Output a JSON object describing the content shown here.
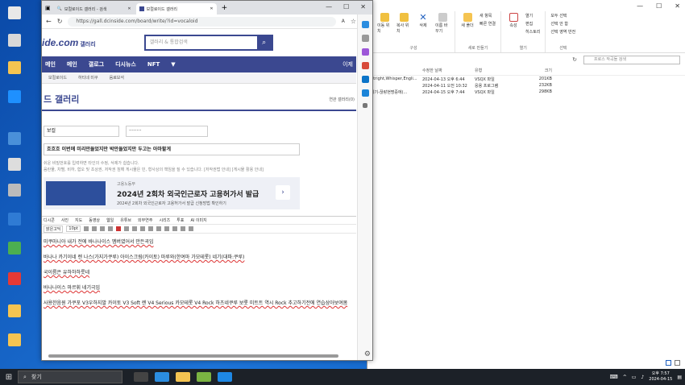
{
  "browser": {
    "tabs": [
      {
        "title": "보컬로이드 갤러리 - 검색"
      },
      {
        "title": "보컬로이드 갤러리"
      }
    ],
    "new_tab": "+",
    "url": "https://gall.dcinside.com/board/write/?id=vocaloid"
  },
  "site": {
    "logo": "ide.com",
    "logo_sub": "갤러리",
    "search_placeholder": "갤러리 & 통합검색",
    "menu": [
      "메인",
      "메인",
      "갤로그",
      "디시뉴스",
      "NFT"
    ],
    "menu_right": "이제",
    "sub_menu": [
      "보컬로이드",
      "하티네 미쿠",
      "음료보석"
    ],
    "gallery_title": "드 갤러리",
    "gallery_link": "연관 갤러리(0)"
  },
  "form": {
    "nickname": "보컬",
    "password": "········",
    "subject": "흐흐흐 이번에 미리만들었지만 박만들었지만 두고는 아마할게",
    "notice1": "쉬운 비밀번호를 입력하면 타인의 수정, 삭제가 쉽습니다.",
    "notice2": "음란물, 차별, 비하, 혐오 및 초상권, 저작권 침해 게시물은 민, 형사상의 책임을 질 수 있습니다. [저작권법 안내] [게시물 활용 안내]"
  },
  "ad": {
    "small": "고용노동부",
    "headline": "2024년 2회차 외국인근로자 고용허가서 발급",
    "desc": "2024년 2회차 외국인근로자 고용허가서 발급 신청방법 확인하기"
  },
  "toolbar": {
    "row1": [
      "디시콘",
      "사진",
      "지도",
      "동영상",
      "웹일",
      "유튜브",
      "외부연주",
      "시리즈",
      "투표",
      "AI 이미지"
    ],
    "font": "맑은고딕",
    "size": "10pt"
  },
  "editor": {
    "lines": [
      "미쿠마니아 내가 전에 바나나이스 멤버였어서 만든곡임",
      "바나나 카기이네 렌 나스(가지가쿠루)  아이스크림(카이토) 마루와(한여마 가모테롯) 네기(대파:쿠루)",
      "국이름은 유하하하릇네",
      "바나나이스 마르휘 네기극임",
      "사용한음원 가쿠포 V3우하지발  카이토 V3 Soft 렌 V4 Serious 카모테롯 V4 Rock 하츠네쿠루 보롯 미트트 역시 Rock 추고하기전에 연습삼아보여봄"
    ]
  },
  "explorer": {
    "ribbon": {
      "groups": [
        {
          "caption": "구성",
          "buttons": [
            "이동 위치",
            "복사 위치",
            "삭제",
            "이름 바꾸기"
          ]
        },
        {
          "caption": "새로 만들기",
          "buttons": [
            "새 폴더",
            "새 항목",
            "빠른 연결"
          ]
        },
        {
          "caption": "열기",
          "buttons": [
            "속성",
            "열기",
            "편집",
            "히스토리"
          ]
        },
        {
          "caption": "선택",
          "buttons": [
            "모두 선택",
            "선택 안 함",
            "선택 영역 반전"
          ]
        }
      ]
    },
    "search_placeholder": "프로스 작곡들 검색",
    "columns": [
      "",
      "수정한 날짜",
      "유형",
      "크기"
    ],
    "rows": [
      {
        "name": "Stright,Whisper,Engli...",
        "date": "2024-04-13 오후 6:44",
        "type": "VSQX 파일",
        "size": "201KB"
      },
      {
        "name": "",
        "date": "2024-04-11 오전 10:32",
        "type": "응용 프로그램",
        "size": "232KB"
      },
      {
        "name": "네기-끊랑현명중에(...",
        "date": "2024-04-15 오후 7:44",
        "type": "VSQX 파일",
        "size": "298KB"
      }
    ]
  },
  "taskbar": {
    "search": "찾기",
    "time": "오후 7:57",
    "date": "2024-04-15"
  }
}
